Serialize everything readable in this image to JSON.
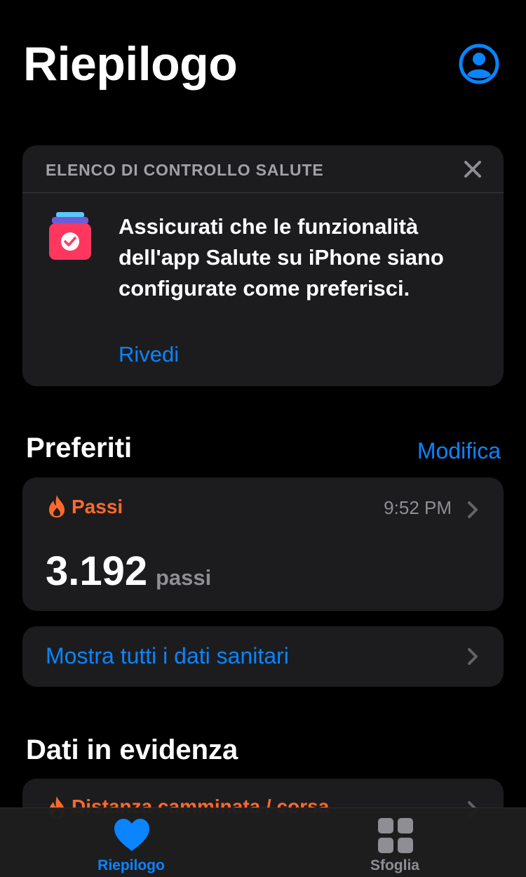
{
  "header": {
    "title": "Riepilogo",
    "profile_icon": "person-circle-icon"
  },
  "checklist": {
    "title": "ELENCO DI CONTROLLO SALUTE",
    "close_icon": "close-icon",
    "icon": "health-checklist-icon",
    "message": "Assicurati che le funzionalità dell'app Salute su iPhone siano configurate come preferisci.",
    "action": "Rivedi"
  },
  "favorites": {
    "title": "Preferiti",
    "edit": "Modifica",
    "steps": {
      "icon": "flame-icon",
      "label": "Passi",
      "time": "9:52 PM",
      "value": "3.192",
      "unit": "passi"
    },
    "show_all": "Mostra tutti i dati sanitari"
  },
  "highlights": {
    "title": "Dati in evidenza",
    "first_item": "Distanza camminata / corsa"
  },
  "tabbar": {
    "tabs": [
      {
        "label": "Riepilogo",
        "icon": "heart-icon",
        "active": true
      },
      {
        "label": "Sfoglia",
        "icon": "grid-icon",
        "active": false
      }
    ]
  },
  "colors": {
    "accent": "#0a84ff",
    "activity": "#ff6a2b",
    "card": "#1c1c1e",
    "background": "#000000"
  }
}
